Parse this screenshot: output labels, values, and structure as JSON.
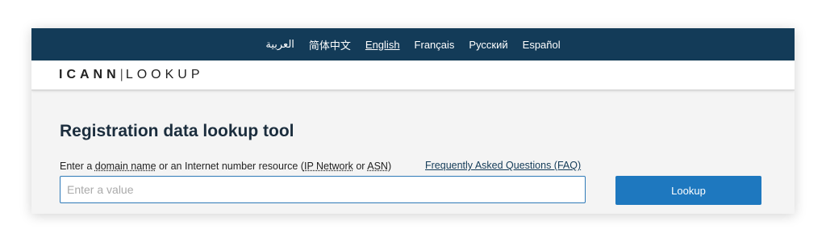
{
  "languages": [
    {
      "label": "العربية",
      "active": false
    },
    {
      "label": "简体中文",
      "active": false
    },
    {
      "label": "English",
      "active": true
    },
    {
      "label": "Français",
      "active": false
    },
    {
      "label": "Русский",
      "active": false
    },
    {
      "label": "Español",
      "active": false
    }
  ],
  "brand": {
    "part1": "ICANN",
    "separator": "|",
    "part2": "LOOKUP"
  },
  "main": {
    "title": "Registration data lookup tool",
    "instruction": {
      "t1": "Enter a ",
      "domain_name": "domain name",
      "t2": " or an Internet number resource (",
      "ip_network": "IP Network",
      "t3": " or ",
      "asn": "ASN",
      "t4": ")"
    },
    "faq_link": "Frequently Asked Questions (FAQ)",
    "search": {
      "placeholder": "Enter a value",
      "value": ""
    },
    "lookup_button": "Lookup"
  },
  "colors": {
    "nav_bg": "#133b58",
    "button_bg": "#1e78bf",
    "input_border": "#2f7ab8",
    "title_text": "#1b2d3d"
  }
}
